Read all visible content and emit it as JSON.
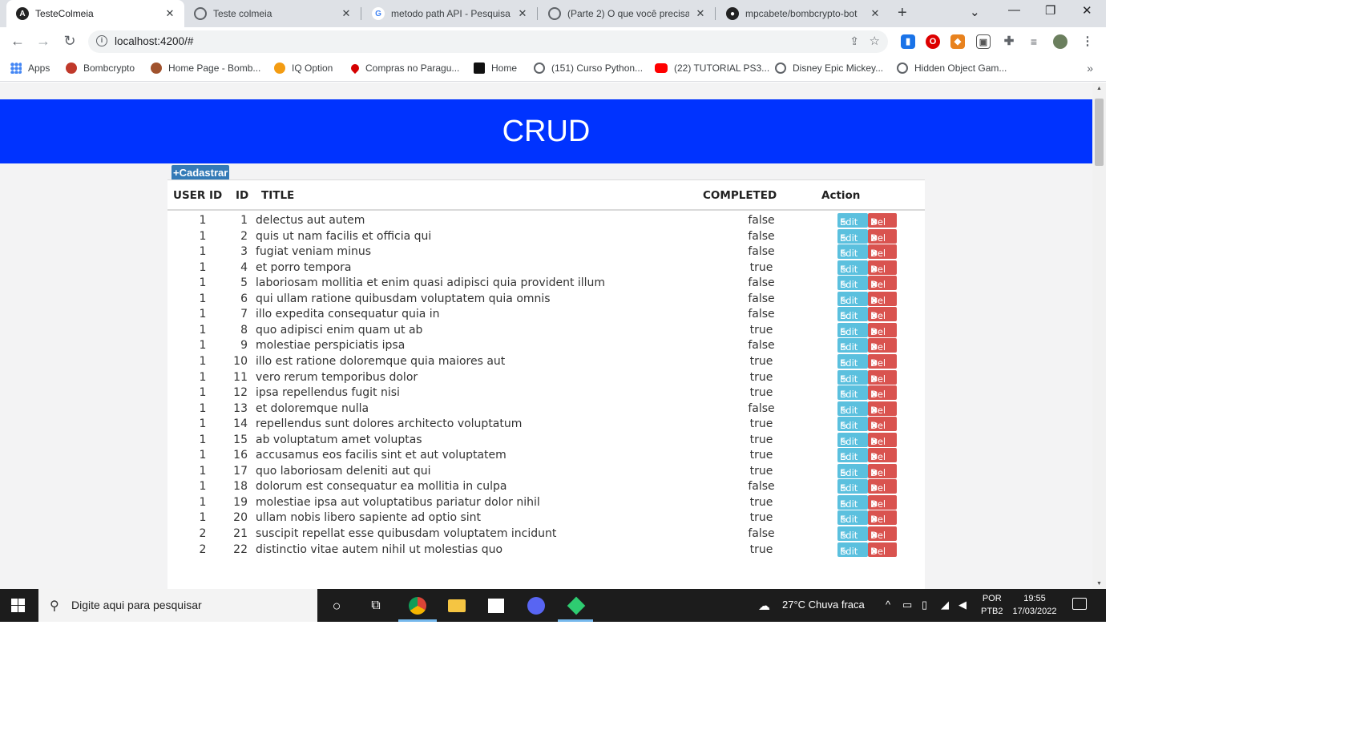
{
  "browser": {
    "tabs": [
      {
        "title": "TesteColmeia",
        "icon": "angular-icon",
        "active": true
      },
      {
        "title": "Teste colmeia",
        "icon": "globe-icon"
      },
      {
        "title": "metodo path API - Pesquisa Google",
        "icon": "google-icon"
      },
      {
        "title": "(Parte 2) O que você precisa",
        "icon": "globe-icon"
      },
      {
        "title": "mpcabete/bombcrypto-bot",
        "icon": "github-icon"
      }
    ],
    "url": "localhost:4200/#",
    "bookmarks": [
      {
        "label": "Apps",
        "icon": "apps-grid-icon"
      },
      {
        "label": "Bombcrypto",
        "icon": "bombcrypto-icon"
      },
      {
        "label": "Home Page - Bomb...",
        "icon": "bombcrypto-icon"
      },
      {
        "label": "IQ Option",
        "icon": "iq-option-icon"
      },
      {
        "label": "Compras no Paragu...",
        "icon": "map-pin-icon"
      },
      {
        "label": "Home",
        "icon": "notion-icon"
      },
      {
        "label": "(151) Curso Python...",
        "icon": "globe-icon"
      },
      {
        "label": "(22) TUTORIAL PS3...",
        "icon": "youtube-icon"
      },
      {
        "label": "Disney Epic Mickey...",
        "icon": "globe-icon"
      },
      {
        "label": "Hidden Object Gam...",
        "icon": "globe-icon"
      }
    ]
  },
  "page": {
    "header_title": "CRUD",
    "add_button_label": "+Cadastrar",
    "columns": [
      "USER ID",
      "ID",
      "TITLE",
      "COMPLETED",
      "Action"
    ],
    "edit_label": "Edit",
    "delete_label": "Del",
    "rows": [
      {
        "user_id": "1",
        "id": "1",
        "title": "delectus aut autem",
        "completed": "false"
      },
      {
        "user_id": "1",
        "id": "2",
        "title": "quis ut nam facilis et officia qui",
        "completed": "false"
      },
      {
        "user_id": "1",
        "id": "3",
        "title": "fugiat veniam minus",
        "completed": "false"
      },
      {
        "user_id": "1",
        "id": "4",
        "title": "et porro tempora",
        "completed": "true"
      },
      {
        "user_id": "1",
        "id": "5",
        "title": "laboriosam mollitia et enim quasi adipisci quia provident illum",
        "completed": "false"
      },
      {
        "user_id": "1",
        "id": "6",
        "title": "qui ullam ratione quibusdam voluptatem quia omnis",
        "completed": "false"
      },
      {
        "user_id": "1",
        "id": "7",
        "title": "illo expedita consequatur quia in",
        "completed": "false"
      },
      {
        "user_id": "1",
        "id": "8",
        "title": "quo adipisci enim quam ut ab",
        "completed": "true"
      },
      {
        "user_id": "1",
        "id": "9",
        "title": "molestiae perspiciatis ipsa",
        "completed": "false"
      },
      {
        "user_id": "1",
        "id": "10",
        "title": "illo est ratione doloremque quia maiores aut",
        "completed": "true"
      },
      {
        "user_id": "1",
        "id": "11",
        "title": "vero rerum temporibus dolor",
        "completed": "true"
      },
      {
        "user_id": "1",
        "id": "12",
        "title": "ipsa repellendus fugit nisi",
        "completed": "true"
      },
      {
        "user_id": "1",
        "id": "13",
        "title": "et doloremque nulla",
        "completed": "false"
      },
      {
        "user_id": "1",
        "id": "14",
        "title": "repellendus sunt dolores architecto voluptatum",
        "completed": "true"
      },
      {
        "user_id": "1",
        "id": "15",
        "title": "ab voluptatum amet voluptas",
        "completed": "true"
      },
      {
        "user_id": "1",
        "id": "16",
        "title": "accusamus eos facilis sint et aut voluptatem",
        "completed": "true"
      },
      {
        "user_id": "1",
        "id": "17",
        "title": "quo laboriosam deleniti aut qui",
        "completed": "true"
      },
      {
        "user_id": "1",
        "id": "18",
        "title": "dolorum est consequatur ea mollitia in culpa",
        "completed": "false"
      },
      {
        "user_id": "1",
        "id": "19",
        "title": "molestiae ipsa aut voluptatibus pariatur dolor nihil",
        "completed": "true"
      },
      {
        "user_id": "1",
        "id": "20",
        "title": "ullam nobis libero sapiente ad optio sint",
        "completed": "true"
      },
      {
        "user_id": "2",
        "id": "21",
        "title": "suscipit repellat esse quibusdam voluptatem incidunt",
        "completed": "false"
      },
      {
        "user_id": "2",
        "id": "22",
        "title": "distinctio vitae autem nihil ut molestias quo",
        "completed": "true"
      }
    ]
  },
  "taskbar": {
    "search_placeholder": "Digite aqui para pesquisar",
    "weather": "27°C  Chuva fraca",
    "lang_top": "POR",
    "lang_bottom": "PTB2",
    "time": "19:55",
    "date": "17/03/2022"
  },
  "colors": {
    "header_bg": "#0033ff",
    "edit_btn": "#5bc0de",
    "delete_btn": "#d9534f",
    "add_btn": "#337ab7"
  }
}
